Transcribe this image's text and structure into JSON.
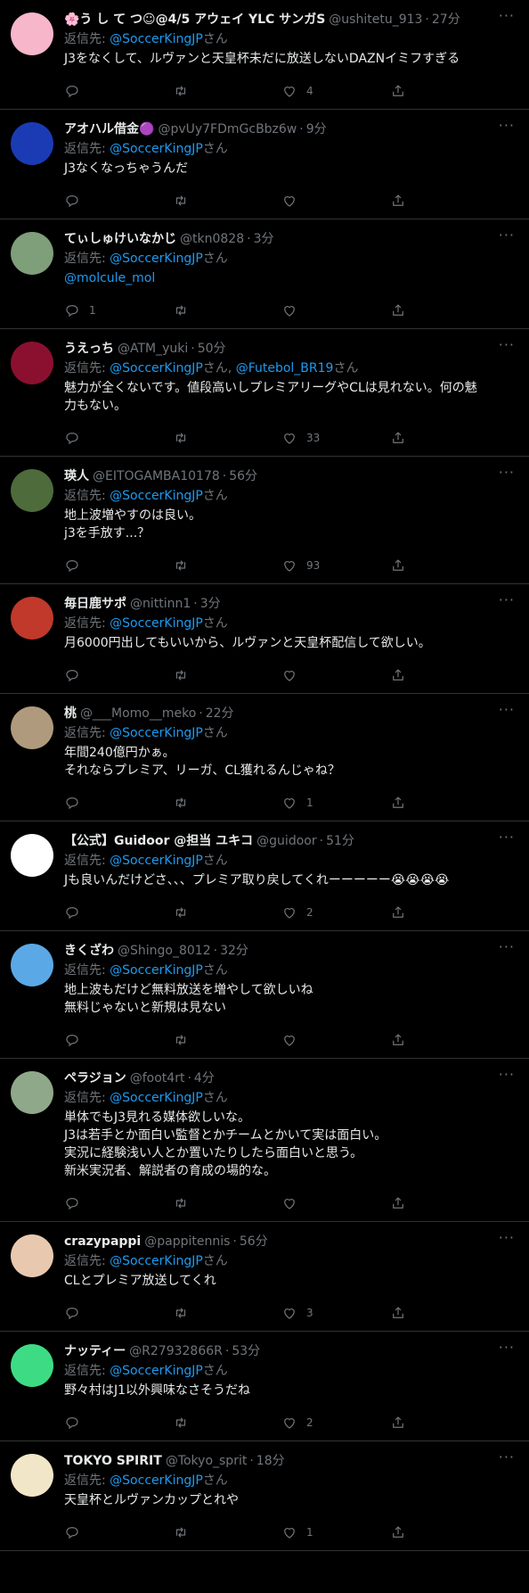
{
  "reply_prefix": "返信先: ",
  "reply_suffix": "さん",
  "tweets": [
    {
      "name": "🌸う し て つ☺@4/5 アウェイ YLC サンガS",
      "handle": "@ushitetu_913",
      "time": "27分",
      "reply_to": "@SoccerKingJP",
      "reply_to2": "",
      "lines": [
        "J3をなくして、ルヴァンと天皇杯未だに放送しないDAZNイミフすぎる"
      ],
      "replies": "",
      "retweets": "",
      "likes": "4",
      "avatar_color": "#f7b6c9"
    },
    {
      "name": "アオハル借金🟣",
      "handle": "@pvUy7FDmGcBbz6w",
      "time": "9分",
      "reply_to": "@SoccerKingJP",
      "reply_to2": "",
      "lines": [
        "J3なくなっちゃうんだ"
      ],
      "replies": "",
      "retweets": "",
      "likes": "",
      "avatar_color": "#1b3bb5"
    },
    {
      "name": "てぃしゅけいなかじ",
      "handle": "@tkn0828",
      "time": "3分",
      "reply_to": "@SoccerKingJP",
      "reply_to2": "",
      "lines": [
        "@molcule_mol"
      ],
      "replies": "1",
      "retweets": "",
      "likes": "",
      "avatar_color": "#7f9e7a"
    },
    {
      "name": "うえっち",
      "handle": "@ATM_yuki",
      "time": "50分",
      "reply_to": "@SoccerKingJP",
      "reply_to2": "@Futebol_BR19",
      "lines": [
        "魅力が全くないです。値段高いしプレミアリーグやCLは見れない。何の魅",
        "力もない。"
      ],
      "replies": "",
      "retweets": "",
      "likes": "33",
      "avatar_color": "#8b1030"
    },
    {
      "name": "瑛人",
      "handle": "@EITOGAMBA10178",
      "time": "56分",
      "reply_to": "@SoccerKingJP",
      "reply_to2": "",
      "lines": [
        "地上波増やすのは良い。",
        "j3を手放す...？"
      ],
      "replies": "",
      "retweets": "",
      "likes": "93",
      "avatar_color": "#4e6b3c"
    },
    {
      "name": "毎日鹿サポ",
      "handle": "@nittinn1",
      "time": "3分",
      "reply_to": "@SoccerKingJP",
      "reply_to2": "",
      "lines": [
        "月6000円出してもいいから、ルヴァンと天皇杯配信して欲しい。"
      ],
      "replies": "",
      "retweets": "",
      "likes": "",
      "avatar_color": "#c0392b"
    },
    {
      "name": "桃",
      "handle": "@___Momo__meko",
      "time": "22分",
      "reply_to": "@SoccerKingJP",
      "reply_to2": "",
      "lines": [
        "年間240億円かぁ。",
        "それならプレミア、リーガ、CL獲れるんじゃね？"
      ],
      "replies": "",
      "retweets": "",
      "likes": "1",
      "avatar_color": "#b09a7e"
    },
    {
      "name": "【公式】Guidoor @担当 ユキコ",
      "handle": "@guidoor",
      "time": "51分",
      "reply_to": "@SoccerKingJP",
      "reply_to2": "",
      "lines": [
        "Jも良いんだけどさ、、、プレミア取り戻してくれーーーーー😭😭😭😭"
      ],
      "replies": "",
      "retweets": "",
      "likes": "2",
      "avatar_color": "#ffffff"
    },
    {
      "name": "きくざわ",
      "handle": "@Shingo_8012",
      "time": "32分",
      "reply_to": "@SoccerKingJP",
      "reply_to2": "",
      "lines": [
        "地上波もだけど無料放送を増やして欲しいね",
        "無料じゃないと新規は見ない"
      ],
      "replies": "",
      "retweets": "",
      "likes": "",
      "avatar_color": "#5aa9e6"
    },
    {
      "name": "ペラジョン",
      "handle": "@foot4rt",
      "time": "4分",
      "reply_to": "@SoccerKingJP",
      "reply_to2": "",
      "lines": [
        "単体でもJ3見れる媒体欲しいな。",
        "J3は若手とか面白い監督とかチームとかいて実は面白い。",
        "実況に経験浅い人とか置いたりしたら面白いと思う。",
        "新米実況者、解説者の育成の場的な。"
      ],
      "replies": "",
      "retweets": "",
      "likes": "",
      "avatar_color": "#8fa88a"
    },
    {
      "name": "crazypappi",
      "handle": "@pappitennis",
      "time": "56分",
      "reply_to": "@SoccerKingJP",
      "reply_to2": "",
      "lines": [
        "CLとプレミア放送してくれ"
      ],
      "replies": "",
      "retweets": "",
      "likes": "3",
      "avatar_color": "#e8c9b0"
    },
    {
      "name": "ナッティー",
      "handle": "@R27932866R",
      "time": "53分",
      "reply_to": "@SoccerKingJP",
      "reply_to2": "",
      "lines": [
        "野々村はJ1以外興味なさそうだね"
      ],
      "replies": "",
      "retweets": "",
      "likes": "2",
      "avatar_color": "#3ddc84"
    },
    {
      "name": "TOKYO SPIRIT",
      "handle": "@Tokyo_sprit",
      "time": "18分",
      "reply_to": "@SoccerKingJP",
      "reply_to2": "",
      "lines": [
        "天皇杯とルヴァンカップとれや"
      ],
      "replies": "",
      "retweets": "",
      "likes": "1",
      "avatar_color": "#f2e6c8"
    }
  ]
}
